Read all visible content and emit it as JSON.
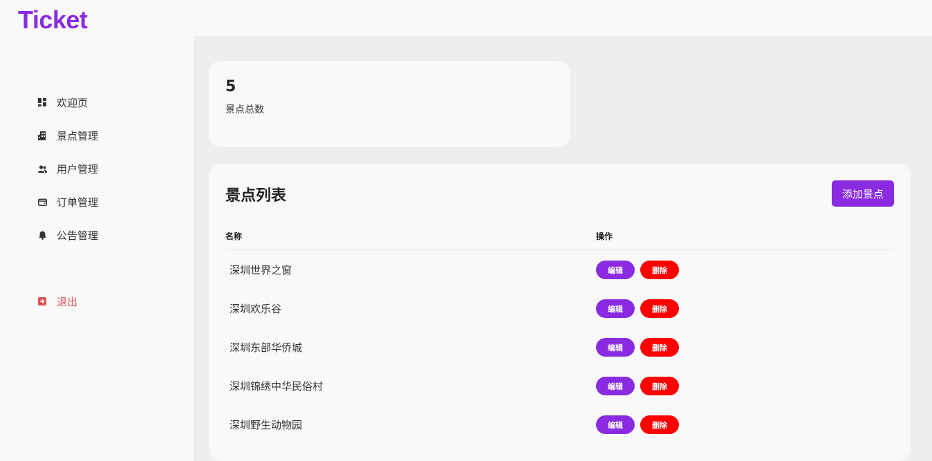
{
  "app": {
    "logo": "Ticket"
  },
  "sidebar": {
    "items": [
      {
        "label": "欢迎页",
        "icon": "dashboard-icon"
      },
      {
        "label": "景点管理",
        "icon": "building-icon"
      },
      {
        "label": "用户管理",
        "icon": "users-icon"
      },
      {
        "label": "订单管理",
        "icon": "wallet-icon"
      },
      {
        "label": "公告管理",
        "icon": "bell-icon"
      }
    ],
    "logout": {
      "label": "退出",
      "icon": "logout-icon",
      "color": "#d9534f"
    }
  },
  "stats": {
    "value": "5",
    "label": "景点总数"
  },
  "attractions": {
    "title": "景点列表",
    "add_label": "添加景点",
    "columns": [
      "名称",
      "操作"
    ],
    "rows": [
      {
        "name": "深圳世界之窗"
      },
      {
        "name": "深圳欢乐谷"
      },
      {
        "name": "深圳东部华侨城"
      },
      {
        "name": "深圳锦绣中华民俗村"
      },
      {
        "name": "深圳野生动物园"
      }
    ],
    "edit_label": "编辑",
    "delete_label": "删除"
  },
  "colors": {
    "accent": "#8a2be2",
    "danger": "#ff0000"
  }
}
